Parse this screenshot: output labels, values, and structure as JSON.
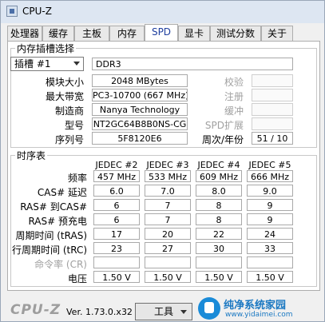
{
  "window": {
    "title": "CPU-Z"
  },
  "tabs": [
    {
      "label": "处理器"
    },
    {
      "label": "缓存"
    },
    {
      "label": "主板"
    },
    {
      "label": "内存"
    },
    {
      "label": "SPD"
    },
    {
      "label": "显卡"
    },
    {
      "label": "测试分数"
    },
    {
      "label": "关于"
    }
  ],
  "active_tab": "SPD",
  "slot_group": {
    "title": "内存插槽选择",
    "slot_select": "插槽 #1",
    "memory_type": "DDR3",
    "labels": {
      "module_size": "模块大小",
      "max_bandwidth": "最大带宽",
      "manufacturer": "制造商",
      "part_number": "型号",
      "serial": "序列号",
      "checksum": "校验",
      "registered": "注册",
      "buffered": "缓冲",
      "spd_ext": "SPD扩展",
      "week_year": "周次/年份"
    },
    "values": {
      "module_size": "2048 MBytes",
      "max_bandwidth": "PC3-10700 (667 MHz)",
      "manufacturer": "Nanya Technology",
      "part_number": "NT2GC64B8B0NS-CG",
      "serial": "5F8120E6",
      "week_year": "51 / 10"
    }
  },
  "timing_group": {
    "title": "时序表",
    "columns": [
      "JEDEC #2",
      "JEDEC #3",
      "JEDEC #4",
      "JEDEC #5"
    ],
    "rows": [
      {
        "label": "频率",
        "values": [
          "457 MHz",
          "533 MHz",
          "609 MHz",
          "666 MHz"
        ]
      },
      {
        "label": "CAS# 延迟",
        "values": [
          "6.0",
          "7.0",
          "8.0",
          "9.0"
        ]
      },
      {
        "label": "RAS# 到CAS#",
        "values": [
          "6",
          "7",
          "8",
          "9"
        ]
      },
      {
        "label": "RAS# 预充电",
        "values": [
          "6",
          "7",
          "8",
          "9"
        ]
      },
      {
        "label": "周期时间 (tRAS)",
        "values": [
          "17",
          "20",
          "22",
          "24"
        ]
      },
      {
        "label": "行周期时间 (tRC)",
        "values": [
          "23",
          "27",
          "30",
          "33"
        ]
      },
      {
        "label": "命令率 (CR)",
        "values": [
          "",
          "",
          "",
          ""
        ]
      },
      {
        "label": "电压",
        "values": [
          "1.50 V",
          "1.50 V",
          "1.50 V",
          "1.50 V"
        ]
      }
    ]
  },
  "footer": {
    "logo": "CPU-Z",
    "version": "Ver. 1.73.0.x32",
    "tools_button": "工具"
  },
  "watermark": {
    "main": "纯净系统家园",
    "sub": "www.yidaimei.com"
  }
}
